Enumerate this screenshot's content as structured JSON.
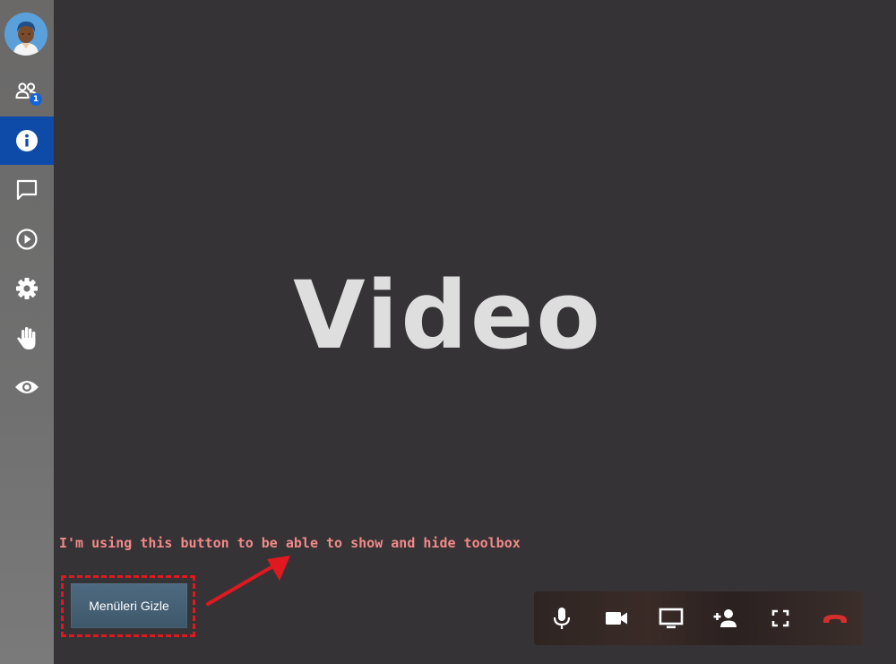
{
  "sidebar": {
    "participants_badge": "1",
    "items": [
      {
        "name": "participants-icon"
      },
      {
        "name": "info-icon",
        "active": true
      },
      {
        "name": "chat-icon"
      },
      {
        "name": "play-icon"
      },
      {
        "name": "settings-icon"
      },
      {
        "name": "raise-hand-icon"
      },
      {
        "name": "eye-icon"
      }
    ]
  },
  "main": {
    "video_label": "Video"
  },
  "annotation": {
    "text": "I'm using this button to be able to show and hide toolbox",
    "color": "#f28a8a",
    "highlight_color": "#e01820"
  },
  "hide_menus_button": {
    "label": "Menüleri Gizle"
  },
  "toolbar": {
    "items": [
      {
        "name": "microphone-icon"
      },
      {
        "name": "camera-icon"
      },
      {
        "name": "screen-share-icon"
      },
      {
        "name": "add-person-icon"
      },
      {
        "name": "fullscreen-icon"
      },
      {
        "name": "hangup-icon",
        "color": "#d32f2f"
      }
    ]
  },
  "colors": {
    "sidebar_active": "#0e4aa8",
    "background": "#353335"
  }
}
